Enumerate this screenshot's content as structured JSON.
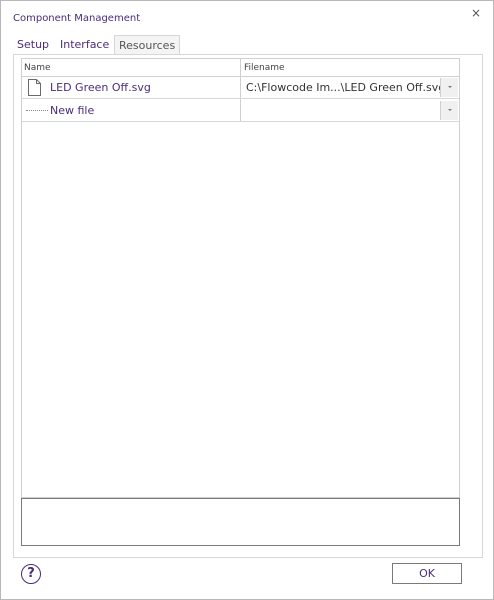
{
  "window": {
    "title": "Component Management",
    "close_glyph": "×"
  },
  "tabs": [
    {
      "label": "Setup",
      "active": false
    },
    {
      "label": "Interface",
      "active": false
    },
    {
      "label": "Resources",
      "active": true
    }
  ],
  "grid": {
    "columns": [
      "Name",
      "Filename"
    ],
    "rows": [
      {
        "name": "LED Green Off.svg",
        "filename": "C:\\Flowcode Im...\\LED Green Off.svg",
        "icon": "file-icon"
      },
      {
        "name": "New file",
        "filename": "",
        "icon": "dotted-line"
      }
    ]
  },
  "footer": {
    "help_glyph": "?",
    "ok_label": "OK"
  },
  "colors": {
    "accent": "#4a2c7a",
    "border": "#d0d0d0",
    "dropdown_bg": "#f0f0f0"
  }
}
